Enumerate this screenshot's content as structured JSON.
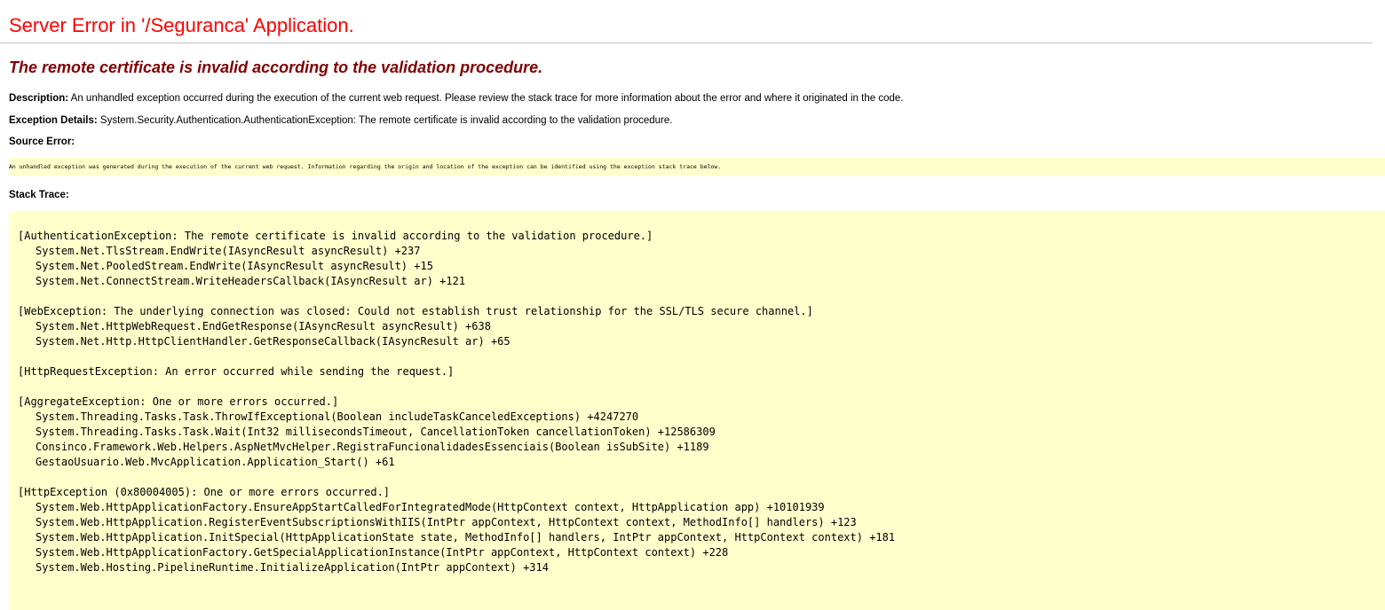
{
  "page": {
    "title": "Server Error in '/Seguranca' Application.",
    "message": "The remote certificate is invalid according to the validation procedure.",
    "description_label": "Description:",
    "description_text": "An unhandled exception occurred during the execution of the current web request. Please review the stack trace for more information about the error and where it originated in the code.",
    "exception_label": "Exception Details:",
    "exception_text": "System.Security.Authentication.AuthenticationException: The remote certificate is invalid according to the validation procedure.",
    "source_error_label": "Source Error:",
    "source_error_text": "An unhandled exception was generated during the execution of the current web request. Information regarding the origin and location of the exception can be identified using the exception stack trace below.",
    "stack_trace_label": "Stack Trace:"
  },
  "stack_trace": [
    {
      "exception": "[AuthenticationException: The remote certificate is invalid according to the validation procedure.]",
      "frames": [
        "System.Net.TlsStream.EndWrite(IAsyncResult asyncResult) +237",
        "System.Net.PooledStream.EndWrite(IAsyncResult asyncResult) +15",
        "System.Net.ConnectStream.WriteHeadersCallback(IAsyncResult ar) +121"
      ]
    },
    {
      "exception": "[WebException: The underlying connection was closed: Could not establish trust relationship for the SSL/TLS secure channel.]",
      "frames": [
        "System.Net.HttpWebRequest.EndGetResponse(IAsyncResult asyncResult) +638",
        "System.Net.Http.HttpClientHandler.GetResponseCallback(IAsyncResult ar) +65"
      ]
    },
    {
      "exception": "[HttpRequestException: An error occurred while sending the request.]",
      "frames": []
    },
    {
      "exception": "[AggregateException: One or more errors occurred.]",
      "frames": [
        "System.Threading.Tasks.Task.ThrowIfExceptional(Boolean includeTaskCanceledExceptions) +4247270",
        "System.Threading.Tasks.Task.Wait(Int32 millisecondsTimeout, CancellationToken cancellationToken) +12586309",
        "Consinco.Framework.Web.Helpers.AspNetMvcHelper.RegistraFuncionalidadesEssenciais(Boolean isSubSite) +1189",
        "GestaoUsuario.Web.MvcApplication.Application_Start() +61"
      ]
    },
    {
      "exception": "[HttpException (0x80004005): One or more errors occurred.]",
      "frames": [
        "System.Web.HttpApplicationFactory.EnsureAppStartCalledForIntegratedMode(HttpContext context, HttpApplication app) +10101939",
        "System.Web.HttpApplication.RegisterEventSubscriptionsWithIIS(IntPtr appContext, HttpContext context, MethodInfo[] handlers) +123",
        "System.Web.HttpApplication.InitSpecial(HttpApplicationState state, MethodInfo[] handlers, IntPtr appContext, HttpContext context) +181",
        "System.Web.HttpApplicationFactory.GetSpecialApplicationInstance(IntPtr appContext, HttpContext context) +228",
        "System.Web.Hosting.PipelineRuntime.InitializeApplication(IntPtr appContext) +314"
      ]
    }
  ],
  "colors": {
    "title": "#ff0000",
    "message": "#800000",
    "code_background": "#ffffcc"
  }
}
